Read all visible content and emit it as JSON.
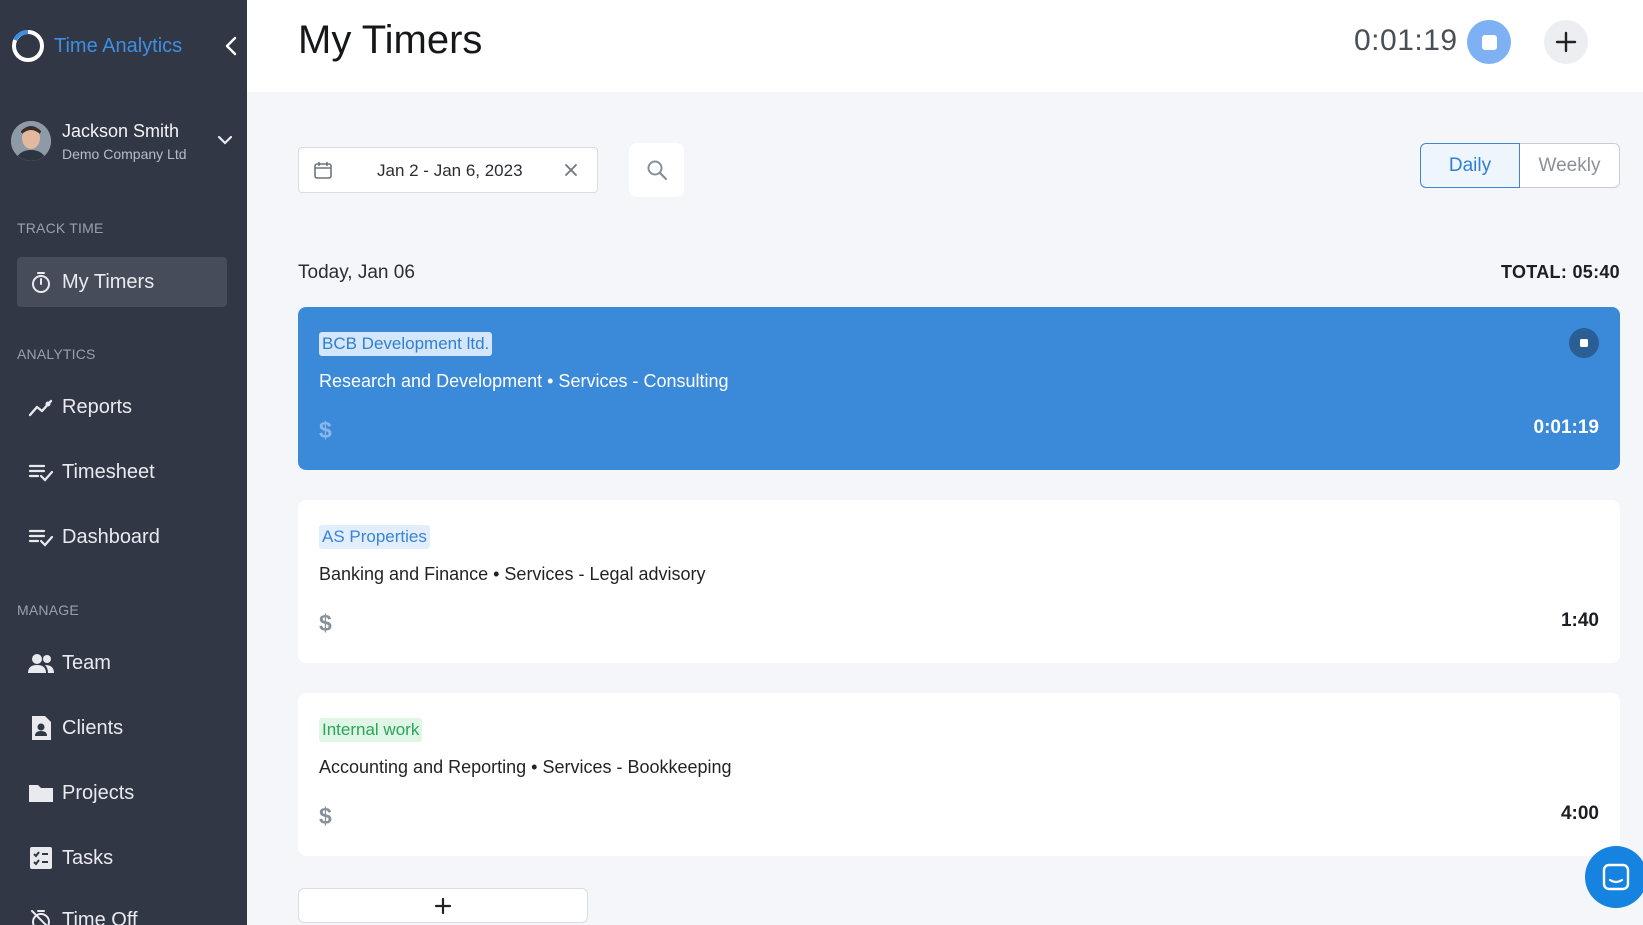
{
  "brand": {
    "name": "Time Analytics",
    "accent": "#3d8fe4"
  },
  "user": {
    "name": "Jackson Smith",
    "company": "Demo Company Ltd"
  },
  "sidebar": {
    "sections": {
      "track": "TRACK TIME",
      "analytics": "ANALYTICS",
      "manage": "MANAGE"
    },
    "items": [
      {
        "label": "My Timers",
        "icon": "stopwatch-icon"
      },
      {
        "label": "Reports",
        "icon": "trend-icon"
      },
      {
        "label": "Timesheet",
        "icon": "list-check-icon"
      },
      {
        "label": "Dashboard",
        "icon": "list-check-icon"
      },
      {
        "label": "Team",
        "icon": "people-icon"
      },
      {
        "label": "Clients",
        "icon": "contact-icon"
      },
      {
        "label": "Projects",
        "icon": "folder-icon"
      },
      {
        "label": "Tasks",
        "icon": "task-icon"
      },
      {
        "label": "Time Off",
        "icon": "timer-off-icon"
      }
    ]
  },
  "header": {
    "title": "My Timers",
    "running_time": "0:01:19"
  },
  "toolbar": {
    "date_range": "Jan 2 - Jan 6, 2023",
    "view_daily": "Daily",
    "view_weekly": "Weekly"
  },
  "day": {
    "label": "Today, Jan 06",
    "total": "TOTAL: 05:40"
  },
  "entries": [
    {
      "client": "BCB Development ltd.",
      "description": "Research and Development • Services - Consulting",
      "billable": "$",
      "time": "0:01:19",
      "running": true
    },
    {
      "client": "AS Properties",
      "description": "Banking and Finance • Services - Legal advisory",
      "billable": "$",
      "time": "1:40",
      "running": false
    },
    {
      "client": "Internal work",
      "description": "Accounting and Reporting • Services - Bookkeeping",
      "billable": "$",
      "time": "4:00",
      "running": false
    }
  ],
  "colors": {
    "sidebar_bg": "#323745",
    "active_card": "#3b8ad9",
    "chat": "#1683e0"
  }
}
